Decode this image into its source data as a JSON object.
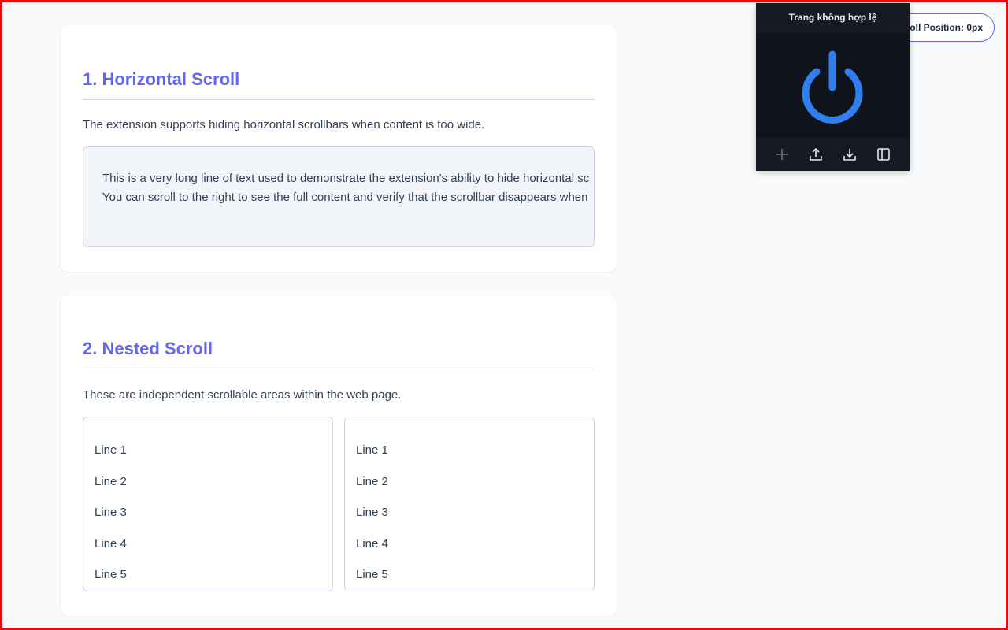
{
  "sections": {
    "horizontal": {
      "title": "1. Horizontal Scroll",
      "description": "The extension supports hiding horizontal scrollbars when content is too wide.",
      "lines": [
        "This is a very long line of text used to demonstrate the extension's ability to hide horizontal sc",
        "You can scroll to the right to see the full content and verify that the scrollbar disappears when"
      ]
    },
    "nested": {
      "title": "2. Nested Scroll",
      "description": "These are independent scrollable areas within the web page.",
      "left_lines": [
        "Line 1",
        "Line 2",
        "Line 3",
        "Line 4",
        "Line 5"
      ],
      "right_lines": [
        "Line 1",
        "Line 2",
        "Line 3",
        "Line 4",
        "Line 5"
      ]
    }
  },
  "scroll_indicator": "roll Position: 0px",
  "popup": {
    "header": "Trang không hợp lệ",
    "power_icon": "power-icon",
    "toolbar": [
      "plus-icon",
      "upload-icon",
      "download-icon",
      "sidebar-icon"
    ],
    "accent": "#2f7fef"
  }
}
